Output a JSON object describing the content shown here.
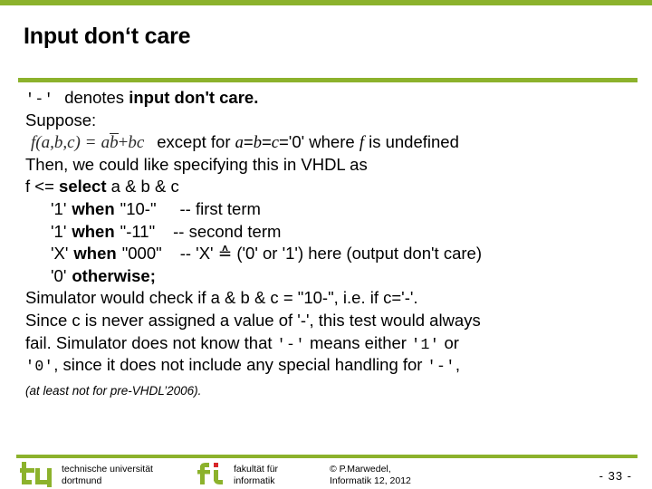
{
  "theme": {
    "accent_green": "#8CB22C",
    "text_color": "#000000",
    "accent_red": "#D8262A"
  },
  "slide": {
    "title": "Input don‘t care"
  },
  "content": {
    "line1": {
      "dash_token": "'-'",
      "text_plain": "denotes ",
      "text_bold": "input don't care."
    },
    "line2": "Suppose:",
    "formula_line": {
      "f_name": "f",
      "args": "(a,b,c)",
      "equals": "=",
      "term1_a": "a",
      "term1_bbar": "b",
      "plus": "+",
      "term2": "bc",
      "after_plain_1": "except for ",
      "after_a": "a",
      "after_eq1": "=",
      "after_b": "b",
      "after_eq2": "=",
      "after_c": "c",
      "after_val": "='0' where ",
      "after_f": "f",
      "after_tail": " is undefined"
    },
    "line4": "Then, we could like specifying this in VHDL as",
    "line5": {
      "pre": "f <= ",
      "kw": "select",
      "post": " a & b & c"
    },
    "cases": [
      {
        "value": "'1'",
        "kw": "when",
        "pattern": "\"10-\"",
        "comment": "-- first term"
      },
      {
        "value": "'1'",
        "kw": "when",
        "pattern": "\"-11\"",
        "comment": "-- second term"
      },
      {
        "value": "'X'",
        "kw": "when",
        "pattern": "\"000\"",
        "comment": "-- 'X' ≙ ('0' or '1') here (output don't care)"
      },
      {
        "value": "'0'",
        "kw": "otherwise;",
        "pattern": "",
        "comment": ""
      }
    ],
    "para1": "Simulator would check if  a & b & c = \"10-\", i.e. if c='-'.",
    "para2_a": "Since c is never assigned a value of '-', this test would always",
    "para3_a": "fail. Simulator does not know that ",
    "para3_dash": "'-'",
    "para3_b": " means either ",
    "para3_one": "'1'",
    "para3_c": " or",
    "para4_zero": "'0'",
    "para4_a": ", since it does not include any special handling for ",
    "para4_dash": "'-'",
    "para4_b": ",",
    "para5": "(at least not for pre-VHDL’2006)."
  },
  "footer": {
    "tu_line1": "technische universität",
    "tu_line2": "dortmund",
    "fi_line1": "fakultät für",
    "fi_line2": "informatik",
    "copyright_line1": "© P.Marwedel,",
    "copyright_line2": "Informatik 12,  2012",
    "page_number": "- 33 -",
    "tu_logo_name": "tu-dortmund-logo",
    "fi_logo_name": "fakultaet-informatik-logo"
  }
}
